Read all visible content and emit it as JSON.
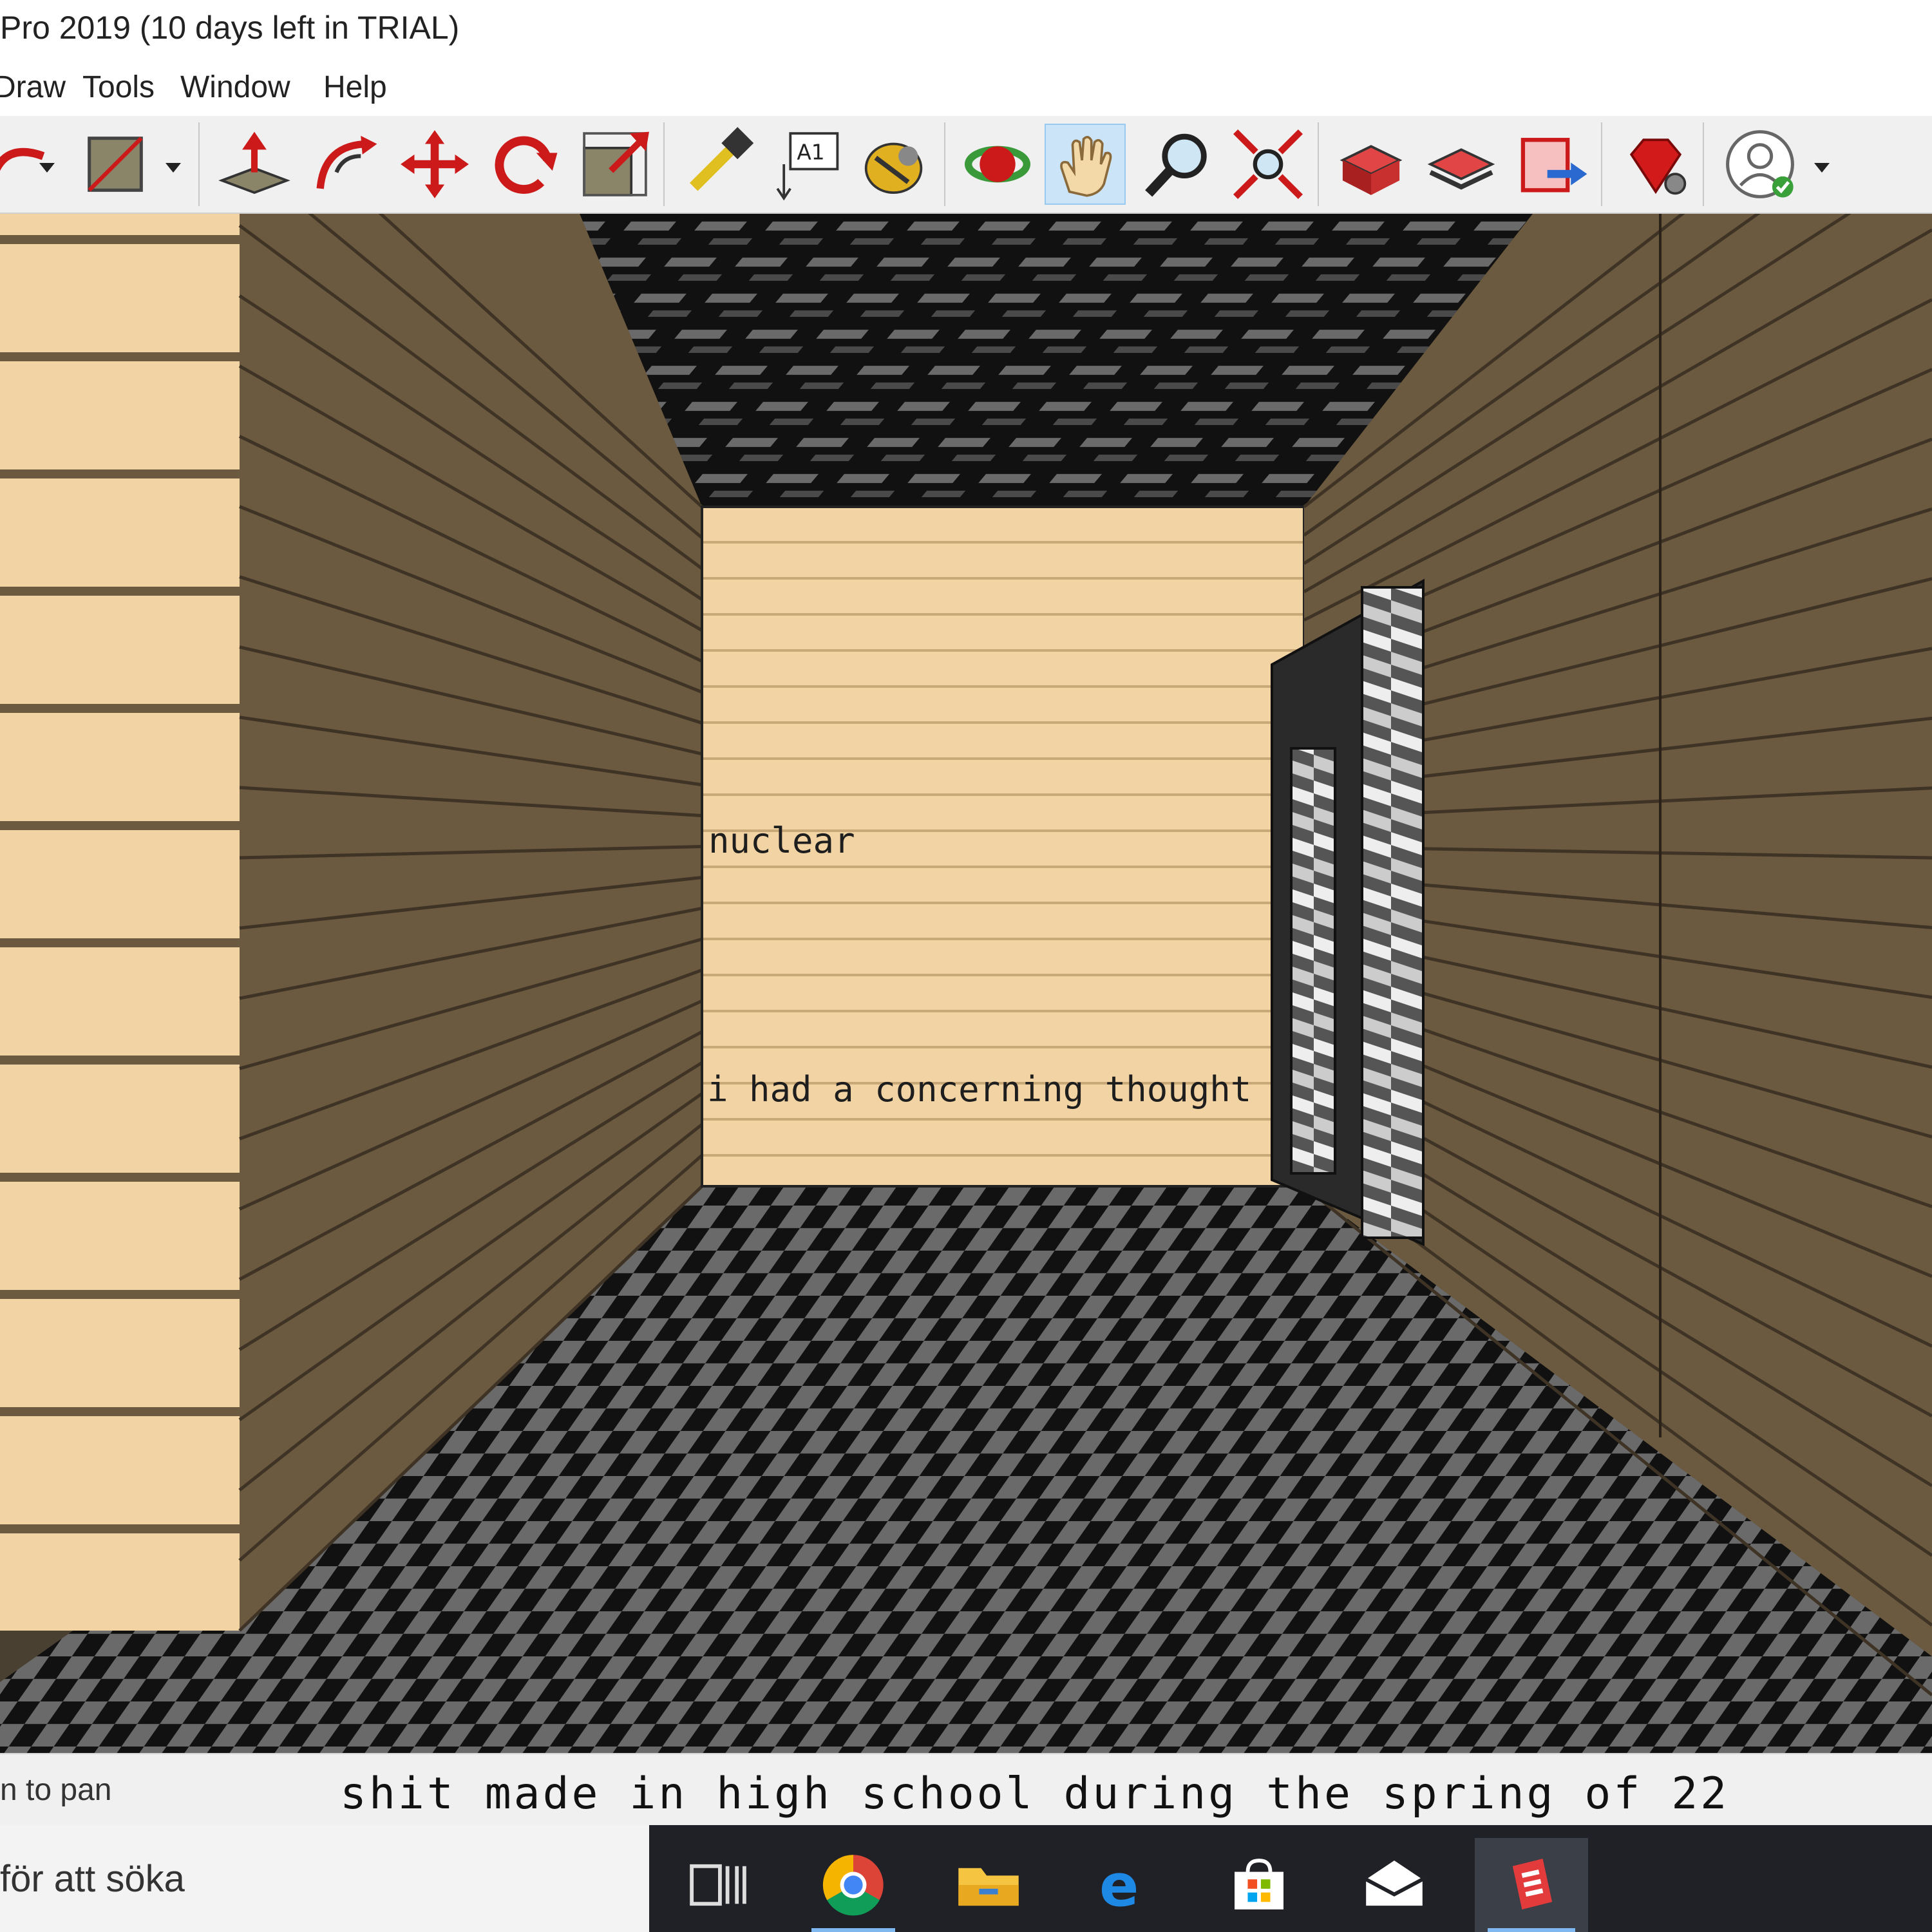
{
  "window": {
    "title": "Pro 2019 (10 days left in TRIAL)"
  },
  "menu": [
    {
      "label": "Draw"
    },
    {
      "label": "Tools"
    },
    {
      "label": "Window"
    },
    {
      "label": "Help"
    }
  ],
  "toolbar": {
    "tools": [
      {
        "name": "arc-tool",
        "icon": "arc-icon"
      },
      {
        "name": "rectangle-tool",
        "icon": "rectangle-icon"
      },
      {
        "name": "push-pull-tool",
        "icon": "push-pull-icon"
      },
      {
        "name": "follow-me-tool",
        "icon": "follow-me-icon"
      },
      {
        "name": "move-tool",
        "icon": "move-icon"
      },
      {
        "name": "rotate-tool",
        "icon": "rotate-icon"
      },
      {
        "name": "scale-tool",
        "icon": "scale-icon"
      },
      {
        "name": "tape-measure-tool",
        "icon": "tape-measure-icon"
      },
      {
        "name": "text-tool",
        "icon": "text-icon",
        "label": "A1"
      },
      {
        "name": "paint-bucket-tool",
        "icon": "paint-bucket-icon"
      },
      {
        "name": "orbit-tool",
        "icon": "orbit-icon"
      },
      {
        "name": "pan-tool",
        "icon": "pan-hand-icon",
        "active": true
      },
      {
        "name": "zoom-tool",
        "icon": "zoom-icon"
      },
      {
        "name": "zoom-extents-tool",
        "icon": "zoom-extents-icon"
      },
      {
        "name": "3d-warehouse-tool",
        "icon": "warehouse-icon"
      },
      {
        "name": "extension-warehouse-tool",
        "icon": "extension-warehouse-icon"
      },
      {
        "name": "send-to-layout-tool",
        "icon": "layout-icon"
      },
      {
        "name": "extension-manager-tool",
        "icon": "ruby-icon"
      },
      {
        "name": "account-tool",
        "icon": "account-icon"
      }
    ]
  },
  "scene": {
    "wall_text_1": "nuclear",
    "wall_text_2": "i had a concerning thought",
    "colors": {
      "wall_light": "#f2d4a4",
      "wall_dark": "#6b5a3f",
      "floor_dark": "#111111",
      "floor_light": "#6a6a6a"
    }
  },
  "status": {
    "hint": "n to pan",
    "caption": "shit made in high school during the spring of 22"
  },
  "taskbar": {
    "search_text": "för att söka",
    "icons": [
      "task-view-icon",
      "chrome-icon",
      "file-explorer-icon",
      "edge-icon",
      "store-icon",
      "mail-icon",
      "sketchup-icon"
    ]
  }
}
